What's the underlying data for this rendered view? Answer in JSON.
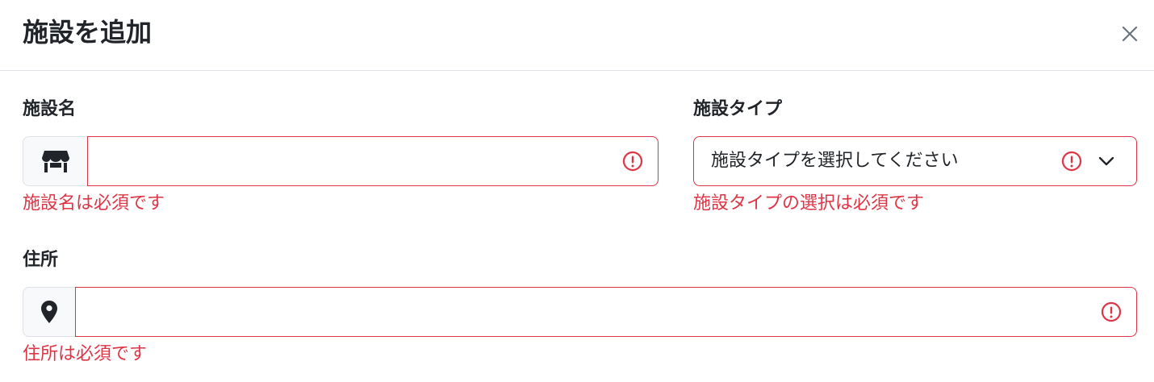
{
  "modal": {
    "title": "施設を追加"
  },
  "fields": {
    "facility_name": {
      "label": "施設名",
      "value": "",
      "placeholder": "",
      "error": "施設名は必須です",
      "icon": "store-icon"
    },
    "facility_type": {
      "label": "施設タイプ",
      "selected": "施設タイプを選択してください",
      "error": "施設タイプの選択は必須です"
    },
    "address": {
      "label": "住所",
      "value": "",
      "placeholder": "",
      "error": "住所は必須です",
      "icon": "location-pin-icon"
    }
  },
  "colors": {
    "error": "#dc3545",
    "border": "#dee2e6",
    "addon_bg": "#f8f9fa"
  }
}
